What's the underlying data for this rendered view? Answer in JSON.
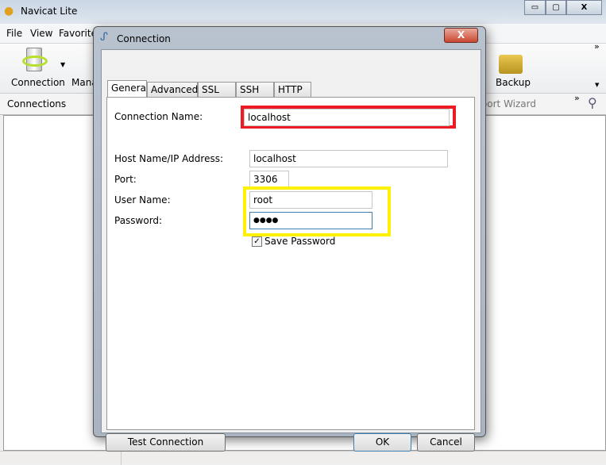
{
  "app": {
    "title": "Navicat Lite",
    "window_controls": [
      "minimize",
      "maximize",
      "close"
    ]
  },
  "menu": [
    "File",
    "View",
    "Favorites"
  ],
  "toolbar": {
    "connection": "Connection",
    "manage": "Manage",
    "backup": "Backup"
  },
  "connbar": {
    "label": "Connections",
    "import_wizard": "Import Wizard"
  },
  "dialog": {
    "title": "Connection",
    "tabs": [
      "General",
      "Advanced",
      "SSL",
      "SSH",
      "HTTP"
    ],
    "active_tab": "General",
    "fields": {
      "connection_name": {
        "label": "Connection Name:",
        "value": "localhost"
      },
      "host": {
        "label": "Host Name/IP Address:",
        "value": "localhost"
      },
      "port": {
        "label": "Port:",
        "value": "3306"
      },
      "user": {
        "label": "User Name:",
        "value": "root"
      },
      "password": {
        "label": "Password:",
        "value": "●●●●"
      }
    },
    "save_password": {
      "label": "Save Password",
      "checked": true
    },
    "buttons": {
      "test": "Test Connection",
      "ok": "OK",
      "cancel": "Cancel"
    },
    "highlight_colors": {
      "connection_name": "#ed1c24",
      "credentials": "#fff200"
    }
  }
}
